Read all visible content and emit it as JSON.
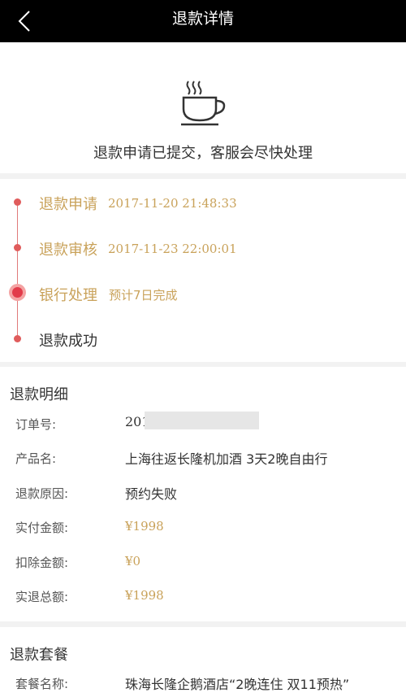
{
  "nav": {
    "title": "退款详情",
    "back_icon": "chevron-left-icon"
  },
  "hero": {
    "icon": "coffee-cup-icon",
    "message": "退款申请已提交，客服会尽快处理"
  },
  "timeline": {
    "steps": [
      {
        "label": "退款申请",
        "time": "2017-11-20 21:48:33",
        "state": "done"
      },
      {
        "label": "退款审核",
        "time": "2017-11-23 22:00:01",
        "state": "done"
      },
      {
        "label": "银行处理",
        "note": "预计7日完成",
        "state": "current"
      },
      {
        "label": "退款成功",
        "state": "pending"
      }
    ]
  },
  "detail": {
    "title": "退款明细",
    "rows": [
      {
        "key": "订单号:",
        "value": "201"
      },
      {
        "key": "产品名:",
        "value": "上海往返长隆机加酒 3天2晚自由行"
      },
      {
        "key": "退款原因:",
        "value": "预约失败"
      },
      {
        "key": "实付金额:",
        "value": "¥1998"
      },
      {
        "key": "扣除金额:",
        "value": "¥0"
      },
      {
        "key": "实退总额:",
        "value": "¥1998"
      }
    ]
  },
  "package": {
    "title": "退款套餐",
    "rows": [
      {
        "key": "套餐名称:",
        "value": "珠海长隆企鹅酒店“2晚连住 双11预热”"
      }
    ]
  },
  "colors": {
    "accent": "#c9a25a",
    "timeline": "#e05c5c",
    "nav_bg": "#000000"
  }
}
